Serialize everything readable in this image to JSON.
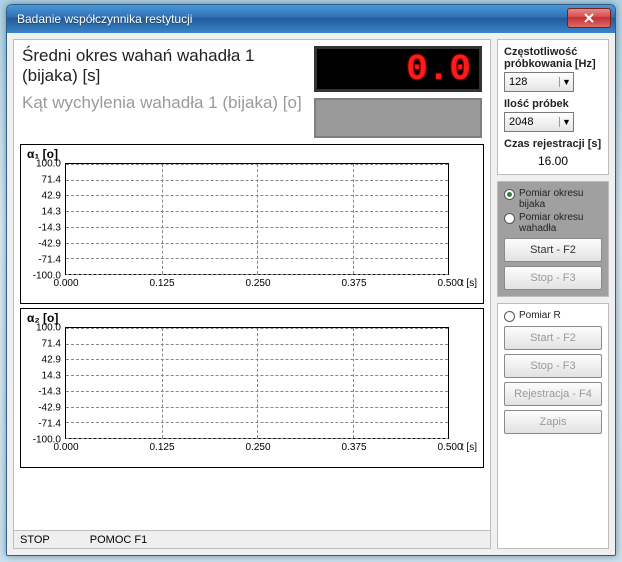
{
  "window": {
    "title": "Badanie współczynnika restytucji"
  },
  "measure": {
    "primary_label": "Średni okres wahań wahadła 1 (bijaka) [s]",
    "secondary_label": "Kąt wychylenia wahadła 1 (bijaka) [o]",
    "primary_value": "0.0"
  },
  "sampling": {
    "freq_label": "Częstotliwość próbkowania [Hz]",
    "freq_value": "128",
    "samples_label": "Ilość próbek",
    "samples_value": "2048",
    "time_label": "Czas rejestracji [s]",
    "time_value": "16.00"
  },
  "acq": {
    "radio1": "Pomiar okresu bijaka",
    "radio2": "Pomiar okresu wahadła",
    "radio_selected": 0,
    "start": "Start - F2",
    "stop": "Stop - F3"
  },
  "reg": {
    "radio": "Pomiar R",
    "start": "Start - F2",
    "stop": "Stop - F3",
    "rec": "Rejestracja - F4",
    "save": "Zapis"
  },
  "status": {
    "left": "STOP",
    "help": "POMOC F1"
  },
  "chart_data": [
    {
      "type": "line",
      "title": "α₁ [o]",
      "xlabel": "t [s]",
      "ylabel": "",
      "xlim": [
        0.0,
        0.5
      ],
      "ylim": [
        -100.0,
        100.0
      ],
      "xticks": [
        0.0,
        0.125,
        0.25,
        0.375,
        0.5
      ],
      "yticks": [
        -100.0,
        -71.4,
        -42.9,
        -14.3,
        14.3,
        42.9,
        71.4,
        100.0
      ],
      "series": [
        {
          "name": "α₁",
          "x": [],
          "y": []
        }
      ]
    },
    {
      "type": "line",
      "title": "α₂ [o]",
      "xlabel": "t [s]",
      "ylabel": "",
      "xlim": [
        0.0,
        0.5
      ],
      "ylim": [
        -100.0,
        100.0
      ],
      "xticks": [
        0.0,
        0.125,
        0.25,
        0.375,
        0.5
      ],
      "yticks": [
        -100.0,
        -71.4,
        -42.9,
        -14.3,
        14.3,
        42.9,
        71.4,
        100.0
      ],
      "series": [
        {
          "name": "α₂",
          "x": [],
          "y": []
        }
      ]
    }
  ]
}
